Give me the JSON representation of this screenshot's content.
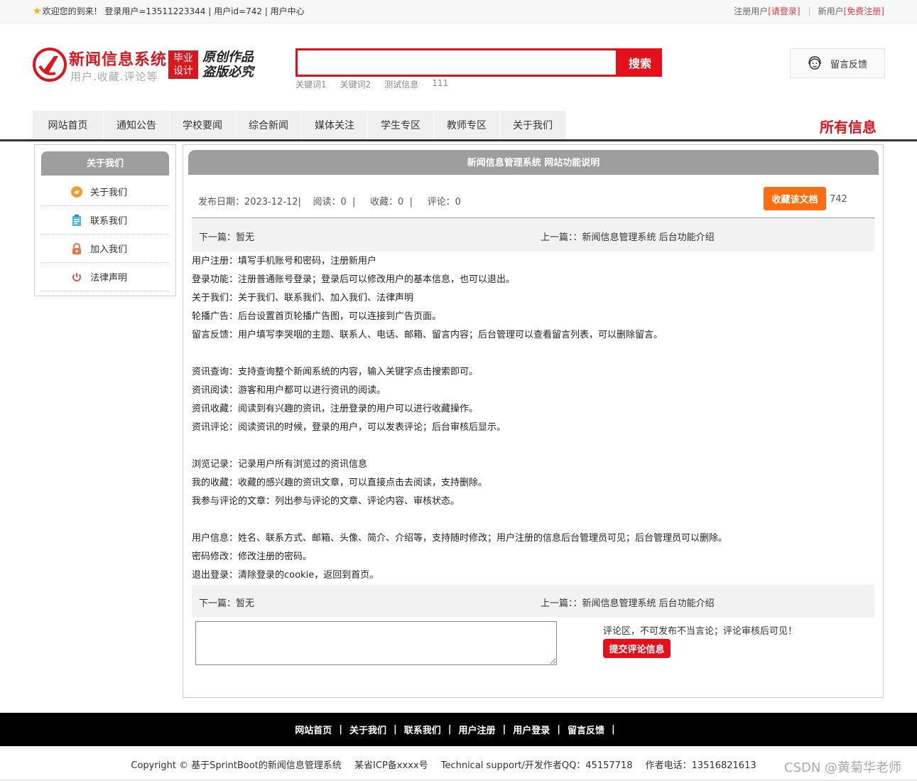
{
  "topbar": {
    "welcome": "欢迎您的到来！ 登录用户=13511223344 | 用户id=742 | 用户中心",
    "registered_label": "注册用户",
    "login_link": "[请登录]",
    "new_user_label": "新用户",
    "register_link": "[免费注册]"
  },
  "header": {
    "logo_title": "新闻信息系统",
    "logo_sub": "用户.收藏.评论等",
    "badge_line1": "毕业",
    "badge_line2": "设计",
    "slogan_line1": "原创作品",
    "slogan_line2": "盗版必究",
    "search_button": "搜索",
    "search_value": "",
    "hotwords": [
      "关键词1",
      "关键词2",
      "测试信息",
      "111"
    ],
    "feedback": "留言反馈"
  },
  "nav": {
    "items": [
      "网站首页",
      "通知公告",
      "学校要闻",
      "综合新闻",
      "媒体关注",
      "学生专区",
      "教师专区",
      "关于我们"
    ],
    "all_info": "所有信息"
  },
  "sidebar": {
    "title": "关于我们",
    "items": [
      {
        "label": "关于我们",
        "icon": "about-icon"
      },
      {
        "label": "联系我们",
        "icon": "contact-icon"
      },
      {
        "label": "加入我们",
        "icon": "lock-icon"
      },
      {
        "label": "法律声明",
        "icon": "power-icon"
      }
    ]
  },
  "article": {
    "title": "新闻信息管理系统 网站功能说明",
    "meta": "发布日期：2023-12-12|    阅读：0  |     收藏：0  |     评论：0",
    "favorite_button": "收藏该文档",
    "favorite_count": "742",
    "prev": "下一篇：暂无",
    "next": "上一篇：：新闻信息管理系统 后台功能介绍",
    "lines": [
      "用户注册：填写手机账号和密码，注册新用户",
      "登录功能：注册普通账号登录；登录后可以修改用户的基本信息，也可以退出。",
      "关于我们：关于我们、联系我们、加入我们、法律声明",
      "轮播广告：后台设置首页轮播广告图，可以连接到广告页面。",
      "留言反馈：用户填写李哭咽的主题、联系人、电话、邮箱、留言内容；后台管理可以查看留言列表，可以删除留言。",
      "",
      "资讯查询：支持查询整个新闻系统的内容，输入关键字点击搜索即可。",
      "资讯阅读：游客和用户都可以进行资讯的阅读。",
      "资讯收藏：阅读到有兴趣的资讯，注册登录的用户可以进行收藏操作。",
      "资讯评论：阅读资讯的时候，登录的用户，可以发表评论；后台审核后显示。",
      "",
      "浏览记录：记录用户所有浏览过的资讯信息",
      "我的收藏：收藏的感兴趣的资讯文章，可以直接点击去阅读，支持删除。",
      "我参与评论的文章：列出参与评论的文章、评论内容、审核状态。",
      "",
      "用户信息：姓名、联系方式、邮箱、头像、简介、介绍等，支持随时修改；用户注册的信息后台管理员可见；后台管理员可以删除。",
      "密码修改：修改注册的密码。",
      "退出登录：清除登录的cookie，返回到首页。"
    ],
    "comment_value": "",
    "comment_note": "评论区，不可发布不当言论；评论审核后可见！",
    "submit_button": "提交评论信息"
  },
  "footer": {
    "links": [
      "网站首页",
      "关于我们",
      "联系我们",
      "用户注册",
      "用户登录",
      "留言反馈"
    ],
    "separator": "|",
    "copyright": "Copyright © 基于SprintBoot的新闻信息管理系统",
    "icp": "某省ICP备xxxx号",
    "support": "Technical support/开发作者QQ：45157718",
    "phone": "作者电话：13516821613",
    "watermark": "CSDN @黄菊华老师"
  },
  "colors": {
    "brand_red": "#e4101c",
    "orange": "#f96e13",
    "grey_head": "#9e9e9e"
  }
}
